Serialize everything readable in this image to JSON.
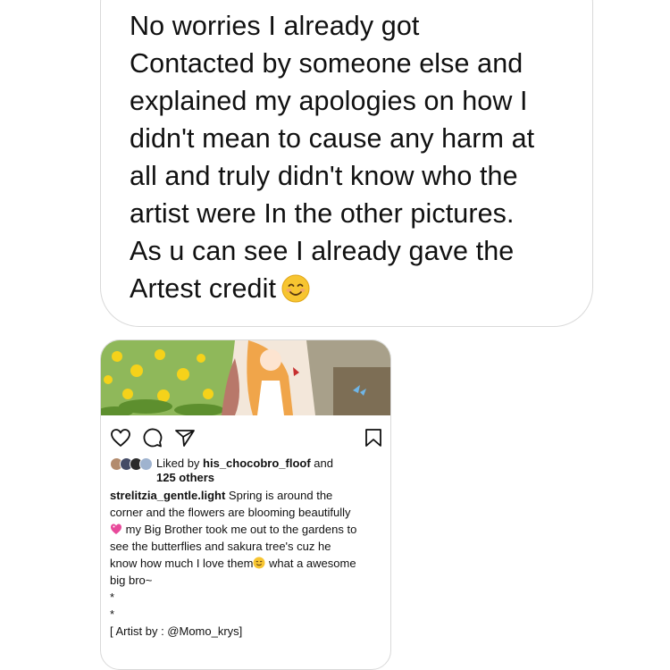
{
  "message": {
    "lines": [
      "No worries I already got",
      "Contacted by someone else and",
      "explained my apologies on how I",
      "didn't mean to cause any harm at",
      "all and truly didn't know who the",
      "artist were In the other pictures.",
      "As u can see I already gave the",
      "Artest credit"
    ],
    "emoji": "smiling-face-emoji"
  },
  "post": {
    "likes_prefix": "Liked by ",
    "likes_user": "his_chocobro_floof",
    "likes_suffix": " and",
    "likes_count": "125 others",
    "caption_user": "strelitzia_gentle.light",
    "caption_lines": [
      " Spring is around the",
      "corner and the flowers are blooming beautifully",
      " my Big Brother took me out to the gardens to",
      "see the butterflies and sakura tree's cuz he",
      "know how much I love them",
      " what a awesome",
      "big bro~",
      "*",
      "*",
      "[ Artist by : @Momo_krys]"
    ],
    "icons": [
      "heart-icon",
      "comment-icon",
      "share-icon",
      "bookmark-icon"
    ]
  }
}
